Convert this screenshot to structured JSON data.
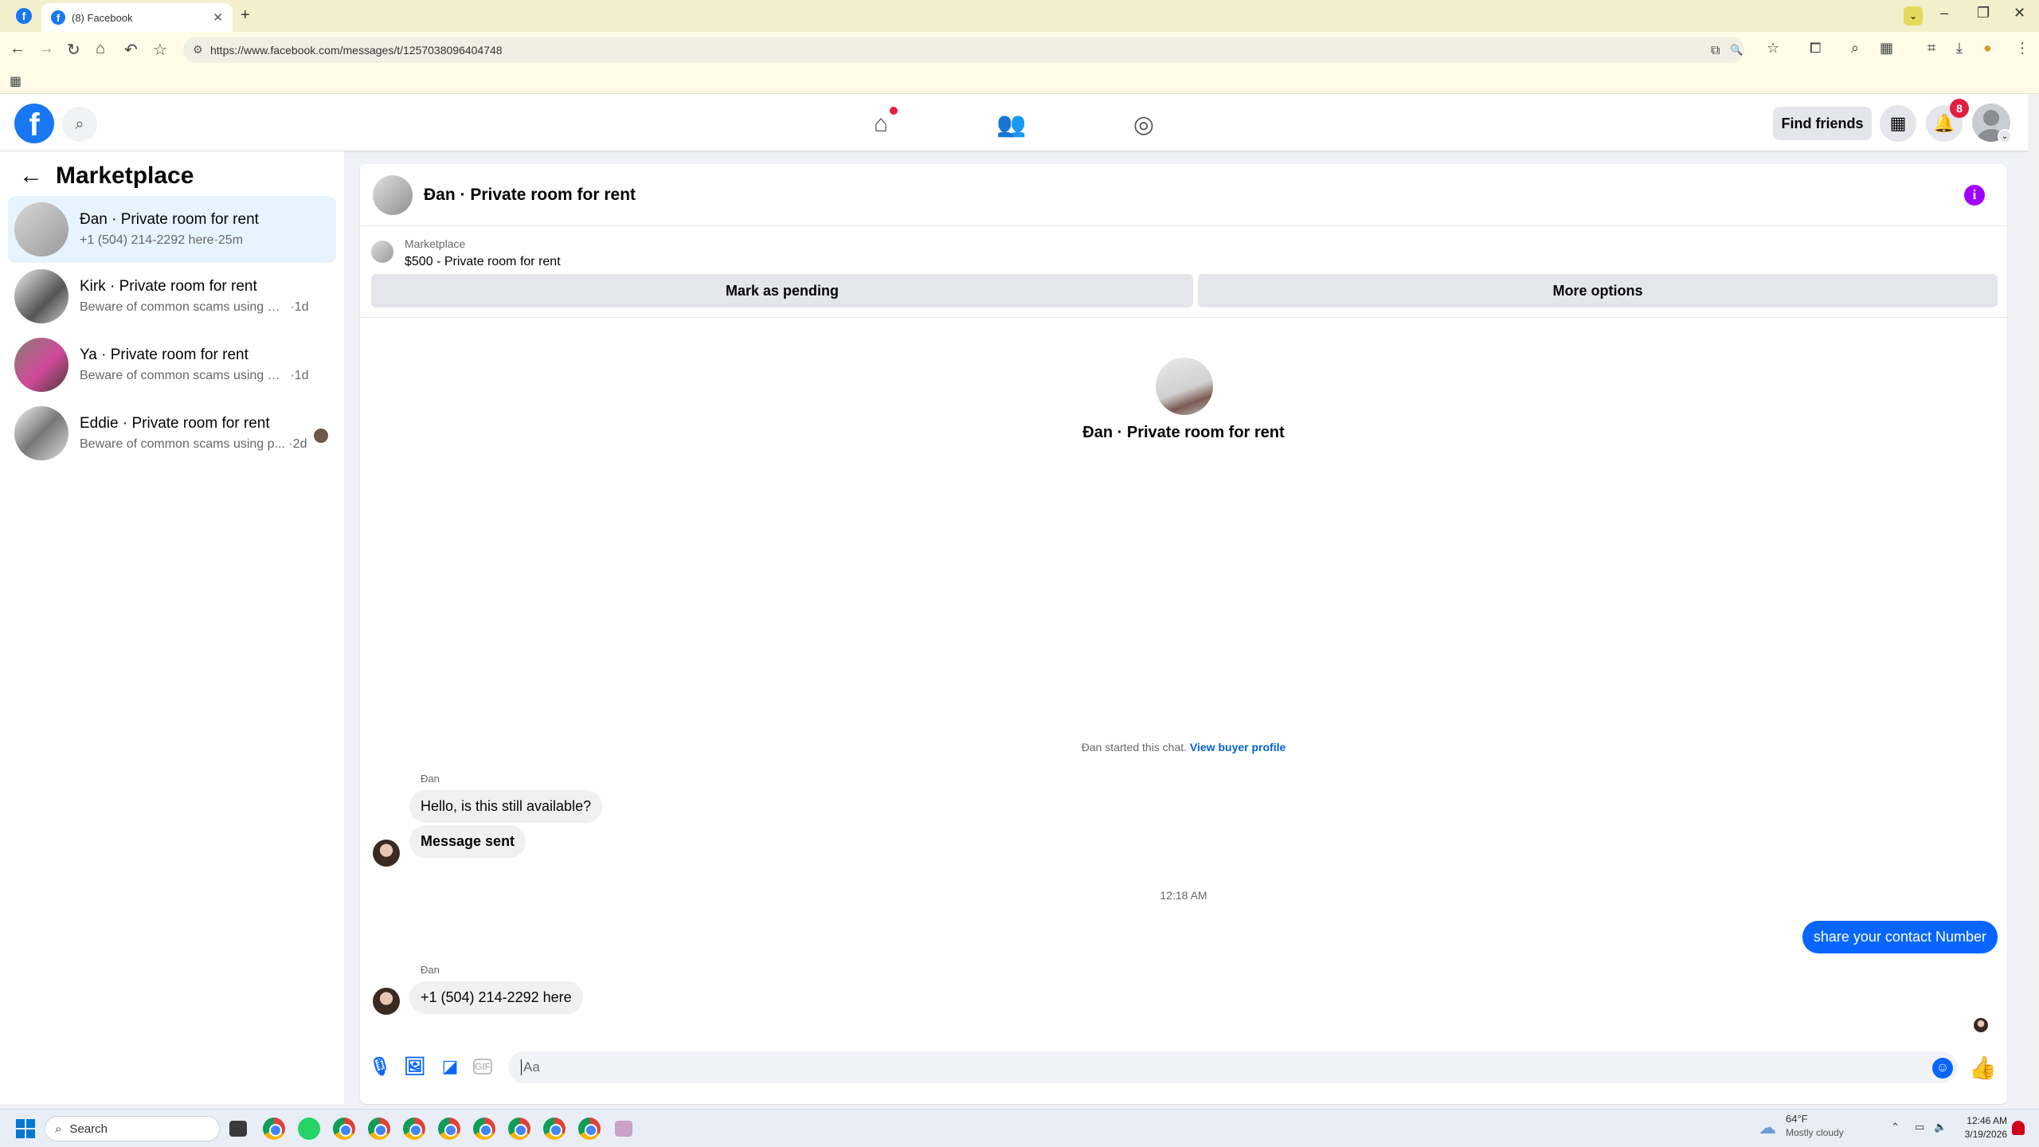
{
  "browser": {
    "tab_title": "(8) Facebook",
    "tab_favicon": "f",
    "url": "https://www.facebook.com/messages/t/1257038096404748",
    "icons": [
      "back-icon",
      "forward-icon",
      "reload-icon",
      "home-icon",
      "undo-icon",
      "star-icon",
      "install-icon",
      "zoom-icon",
      "bookmark-star-icon",
      "extensions-icon",
      "search-icon",
      "tab-groups-icon",
      "crop-icon",
      "download-icon",
      "account-icon",
      "menu-icon"
    ]
  },
  "header": {
    "logo": "f",
    "find_friends": "Find friends",
    "notification_count": "8",
    "nav": [
      "home-icon",
      "friends-icon",
      "groups-icon"
    ]
  },
  "sidebar": {
    "title": "Marketplace",
    "conversations": [
      {
        "name": "Đan · Private room for rent",
        "preview": "+1 (504) 214-2292 here",
        "time": "25m",
        "active": true
      },
      {
        "name": "Kirk · Private room for rent",
        "preview": "Beware of common scams using pay...",
        "time": "1d",
        "active": false
      },
      {
        "name": "Ya · Private room for rent",
        "preview": "Beware of common scams using pay...",
        "time": "1d",
        "active": false
      },
      {
        "name": "Eddie · Private room for rent",
        "preview": "Beware of common scams using p...",
        "time": "2d",
        "active": false
      }
    ]
  },
  "chat": {
    "title": "Đan · Private room for rent",
    "listing_source": "Marketplace",
    "listing_title": "$500 - Private room for rent",
    "mark_pending": "Mark as pending",
    "more_options": "More options",
    "center_name": "Đan · Private room for rent",
    "started_text": "Đan started this chat.",
    "view_profile": "View buyer profile",
    "messages": [
      {
        "sender": "Đan",
        "text": "Hello, is this still available?"
      },
      {
        "text": "Message sent"
      },
      {
        "timestamp": "12:18 AM"
      },
      {
        "outgoing": true,
        "text": "share your contact Number"
      },
      {
        "sender": "Đan",
        "text": "+1 (504) 214-2292 here"
      }
    ],
    "input_placeholder": "Aa",
    "accent": "#0866ff"
  },
  "taskbar": {
    "search_placeholder": "Search",
    "weather_temp": "64°F",
    "weather_desc": "Mostly cloudy",
    "time": "12:46 AM",
    "date": "3/19/2026"
  }
}
